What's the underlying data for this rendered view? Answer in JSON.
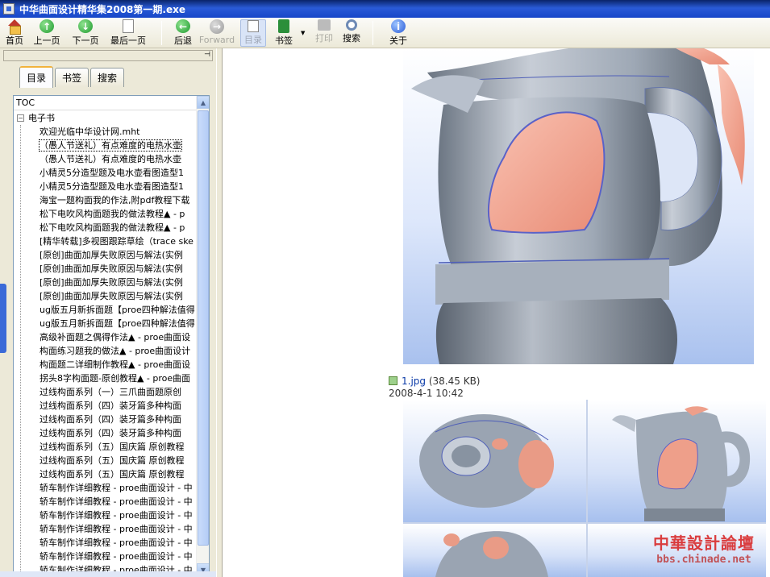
{
  "window": {
    "title": "中华曲面设计精华集2008第一期.exe"
  },
  "toolbar": {
    "home": "首页",
    "prev": "上一页",
    "next": "下一页",
    "last": "最后一页",
    "back": "后退",
    "forward": "Forward",
    "toc": "目录",
    "bookmark": "书签",
    "print": "打印",
    "search": "搜索",
    "about": "关于"
  },
  "sidebar": {
    "tabs": [
      "目录",
      "书签",
      "搜索"
    ],
    "toc_header": "TOC",
    "root_label": "电子书",
    "items": [
      "欢迎光临中华设计网.mht",
      "（愚人节送礼）有点难度的电热水壶",
      "（愚人节送礼）有点难度的电热水壶",
      "小精灵5分造型题及电水壶看图造型1",
      "小精灵5分造型题及电水壶看图造型1",
      "海宝一题构面我的作法,附pdf教程下载",
      "松下电吹风构面题我的做法教程▲ - p",
      "松下电吹风构面题我的做法教程▲ - p",
      "[精华转载]多视图跟踪草绘（trace ske",
      "[原创]曲面加厚失败原因与解法(实例",
      "[原创]曲面加厚失败原因与解法(实例",
      "[原创]曲面加厚失败原因与解法(实例",
      "[原创]曲面加厚失败原因与解法(实例",
      "ug版五月新拆面题【proe四种解法值得",
      "ug版五月新拆面题【proe四种解法值得",
      "高级补面题之偶得作法▲ - proe曲面设",
      "构面练习题我的做法▲ - proe曲面设计",
      "构面题二详细制作教程▲ - proe曲面设",
      "拐头8字构面题-原创教程▲ - proe曲面",
      "过线构面系列（一）三爪曲面题原创",
      "过线构面系列（四）装牙篇多种构面",
      "过线构面系列（四）装牙篇多种构面",
      "过线构面系列（四）装牙篇多种构面",
      "过线构面系列（五）国庆篇 原创教程",
      "过线构面系列（五）国庆篇 原创教程",
      "过线构面系列（五）国庆篇 原创教程",
      "轿车制作详细教程 - proe曲面设计 - 中",
      "轿车制作详细教程 - proe曲面设计 - 中",
      "轿车制作详细教程 - proe曲面设计 - 中",
      "轿车制作详细教程 - proe曲面设计 - 中",
      "轿车制作详细教程 - proe曲面设计 - 中",
      "轿车制作详细教程 - proe曲面设计 - 中",
      "轿车制作详细教程 - proe曲面设计 - 中"
    ]
  },
  "content": {
    "file_name": "1.jpg",
    "file_size": "(38.45 KB)",
    "file_date": "2008-4-1 10:42",
    "watermark_cn": "中華設計論壇",
    "watermark_url": "bbs.chinade.net"
  },
  "colors": {
    "titlebar": "#1646c8",
    "kettle_body": "#8d98a6",
    "kettle_accent": "#f4a390",
    "link": "#0a3aa8"
  }
}
